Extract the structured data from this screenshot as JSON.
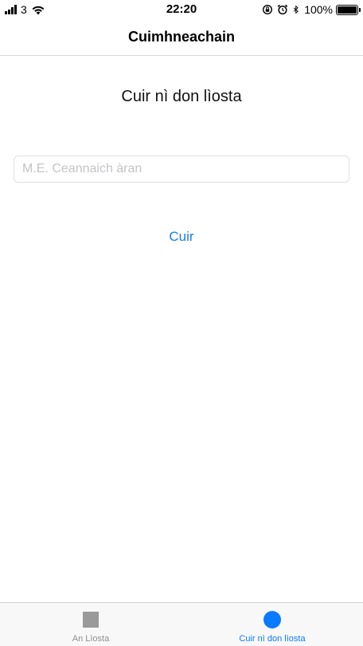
{
  "status_bar": {
    "carrier": "3",
    "time": "22:20",
    "battery_percent": "100%",
    "battery_level": 1.0,
    "icons": [
      "signal-icon",
      "wifi-icon",
      "orientation-lock-icon",
      "alarm-icon",
      "bluetooth-icon",
      "battery-icon"
    ]
  },
  "nav": {
    "title": "Cuimhneachain"
  },
  "main": {
    "heading": "Cuir nì don lìosta",
    "input_placeholder": "M.E. Ceannaich àran",
    "input_value": "",
    "add_button_label": "Cuir"
  },
  "tab_bar": {
    "tabs": [
      {
        "label": "An Lìosta",
        "icon": "square-icon",
        "active": false
      },
      {
        "label": "Cuir nì don lìosta",
        "icon": "circle-icon",
        "active": true
      }
    ]
  },
  "colors": {
    "accent": "#0a7aff",
    "link": "#1a7cf0",
    "inactive_tab": "#8e8e93",
    "placeholder": "#c4c4c8"
  }
}
